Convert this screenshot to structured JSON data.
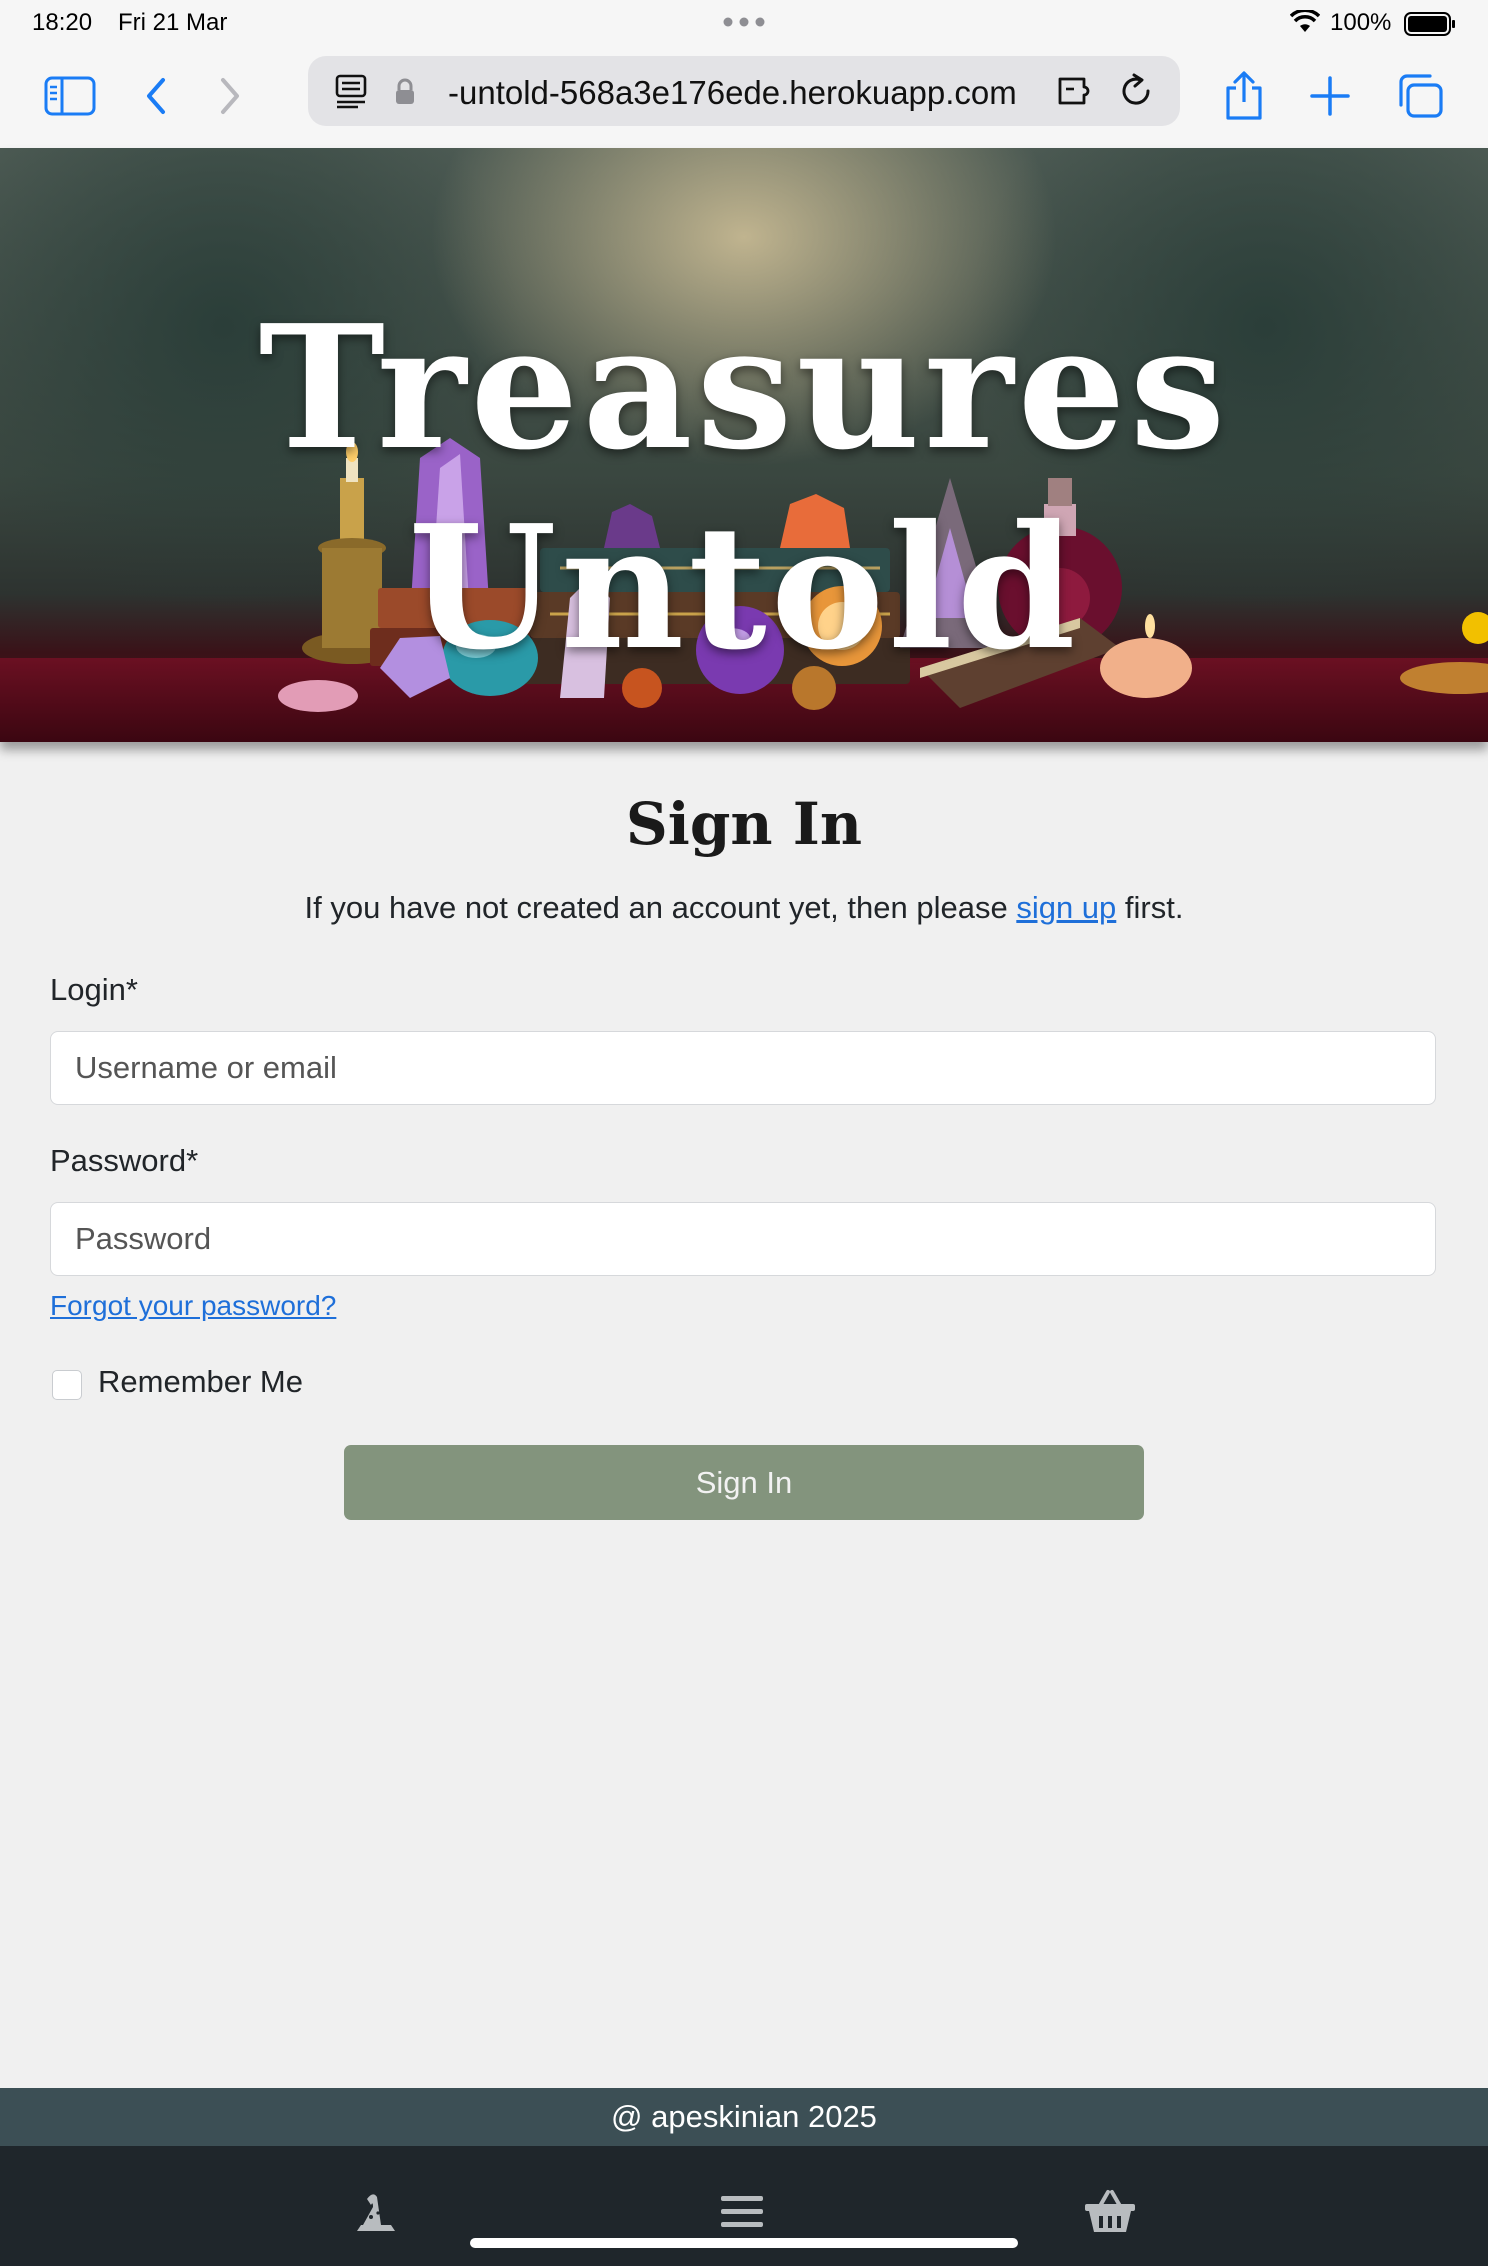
{
  "status_bar": {
    "time": "18:20",
    "date": "Fri 21 Mar",
    "battery": "100%"
  },
  "browser": {
    "url": "-untold-568a3e176ede.herokuapp.com",
    "icons": [
      "sidebar-icon",
      "back-icon",
      "forward-icon",
      "reader-icon",
      "lock-icon",
      "extension-icon",
      "reload-icon",
      "share-icon",
      "new-tab-icon",
      "tabs-icon"
    ],
    "accent": "#1a7cf5"
  },
  "banner": {
    "title": "Treasures Untold"
  },
  "page": {
    "heading": "Sign In",
    "intro_before": "If you have not created an account yet, then please ",
    "intro_link": "sign up",
    "intro_after": " first.",
    "login_label": "Login*",
    "login_placeholder": "Username or email",
    "password_label": "Password*",
    "password_placeholder": "Password",
    "forgot_link": "Forgot your password?",
    "remember_label": "Remember Me",
    "remember_checked": false,
    "submit_label": "Sign In",
    "button_color": "#83947d",
    "link_color": "#1e6fd9"
  },
  "footer": {
    "text": "@ apeskinian 2025"
  },
  "bottom_nav": {
    "icons": [
      "wizard-hat-icon",
      "menu-icon",
      "basket-icon"
    ]
  }
}
